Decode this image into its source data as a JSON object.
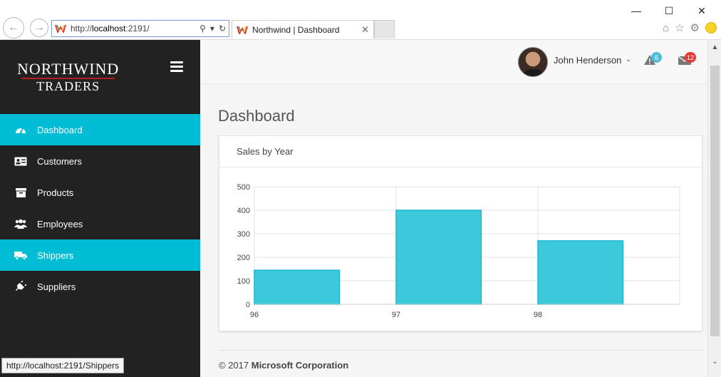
{
  "browser": {
    "url_prefix": "http://",
    "url_host": "localhost",
    "url_rest": ":2191/",
    "tab_title": "Northwind | Dashboard",
    "status_url": "http://localhost:2191/Shippers"
  },
  "brand": {
    "line1": "Northwind",
    "line2": "Traders"
  },
  "sidebar": {
    "items": [
      {
        "label": "Dashboard",
        "icon": "dashboard-icon",
        "active": true
      },
      {
        "label": "Customers",
        "icon": "id-card-icon",
        "active": false
      },
      {
        "label": "Products",
        "icon": "archive-icon",
        "active": false
      },
      {
        "label": "Employees",
        "icon": "users-icon",
        "active": false
      },
      {
        "label": "Shippers",
        "icon": "truck-icon",
        "active": true
      },
      {
        "label": "Suppliers",
        "icon": "plug-icon",
        "active": false
      }
    ]
  },
  "header": {
    "user_name": "John Henderson",
    "alerts_count": "6",
    "messages_count": "12"
  },
  "main": {
    "page_title": "Dashboard",
    "card_title": "Sales by Year",
    "footer_prefix": "© 2017 ",
    "footer_company": "Microsoft Corporation"
  },
  "colors": {
    "accent": "#00bcd4",
    "sidebar_bg": "#222222",
    "bar_fill": "#3cc9dc",
    "bar_stroke": "#1ab8d0"
  },
  "chart_data": {
    "type": "bar",
    "categories": [
      "96",
      "97",
      "98"
    ],
    "values": [
      145,
      400,
      270
    ],
    "title": "Sales by Year",
    "xlabel": "",
    "ylabel": "",
    "ylim": [
      0,
      500
    ],
    "yticks": [
      "0",
      "100",
      "200",
      "300",
      "400",
      "500"
    ],
    "grid": true,
    "legend": "none"
  }
}
